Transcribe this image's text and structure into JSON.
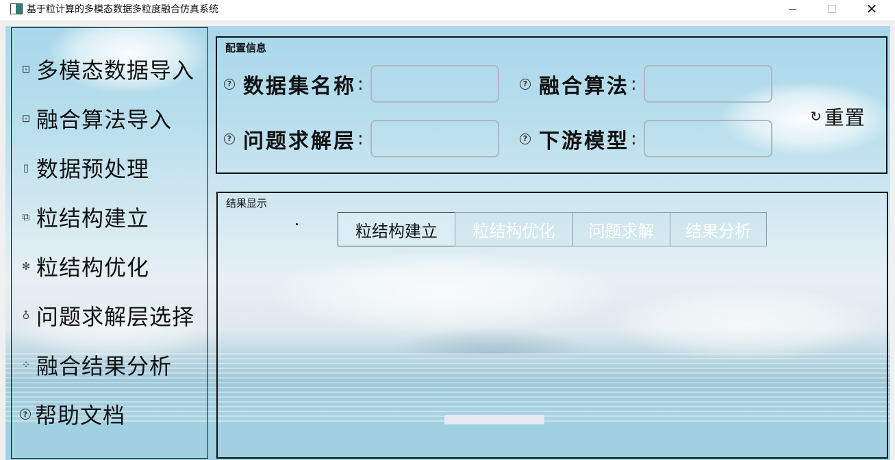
{
  "window": {
    "title": "基于粒计算的多模态数据多粒度融合仿真系统",
    "controls": {
      "minimize": "minimize",
      "maximize": "maximize",
      "close": "✕"
    }
  },
  "sidebar": {
    "items": [
      {
        "label": "多模态数据导入",
        "icon": "import-icon",
        "glyph": "⊡"
      },
      {
        "label": "融合算法导入",
        "icon": "import-icon",
        "glyph": "⊡"
      },
      {
        "label": "数据预处理",
        "icon": "file-settings-icon",
        "glyph": "▯"
      },
      {
        "label": "粒结构建立",
        "icon": "build-icon",
        "glyph": "⧉"
      },
      {
        "label": "粒结构优化",
        "icon": "gear-icon",
        "glyph": "✻"
      },
      {
        "label": "问题求解层选择",
        "icon": "bulb-icon",
        "glyph": "♁"
      },
      {
        "label": "融合结果分析",
        "icon": "loading-icon",
        "glyph": "⁘"
      },
      {
        "label": "帮助文档",
        "icon": "help-icon",
        "glyph": "?"
      }
    ]
  },
  "config": {
    "title": "配置信息",
    "fields": {
      "dataset_name": {
        "label": "数据集名称",
        "value": ""
      },
      "fusion_algorithm": {
        "label": "融合算法",
        "value": ""
      },
      "solving_layer": {
        "label": "问题求解层",
        "value": ""
      },
      "downstream_model": {
        "label": "下游模型",
        "value": ""
      }
    },
    "colon": ":",
    "help_glyph": "?",
    "reset_label": "重置",
    "reset_glyph": "↻"
  },
  "results": {
    "title": "结果显示",
    "tabs": [
      "粒结构建立",
      "粒结构优化",
      "问题求解",
      "结果分析"
    ],
    "active_tab_index": 0
  },
  "colors": {
    "sky_top": "#a9d8ea",
    "sea": "#9fd1e2",
    "border": "#111111",
    "input_border": "#b0b8bf",
    "inactive_tab_text": "#ffffff"
  }
}
